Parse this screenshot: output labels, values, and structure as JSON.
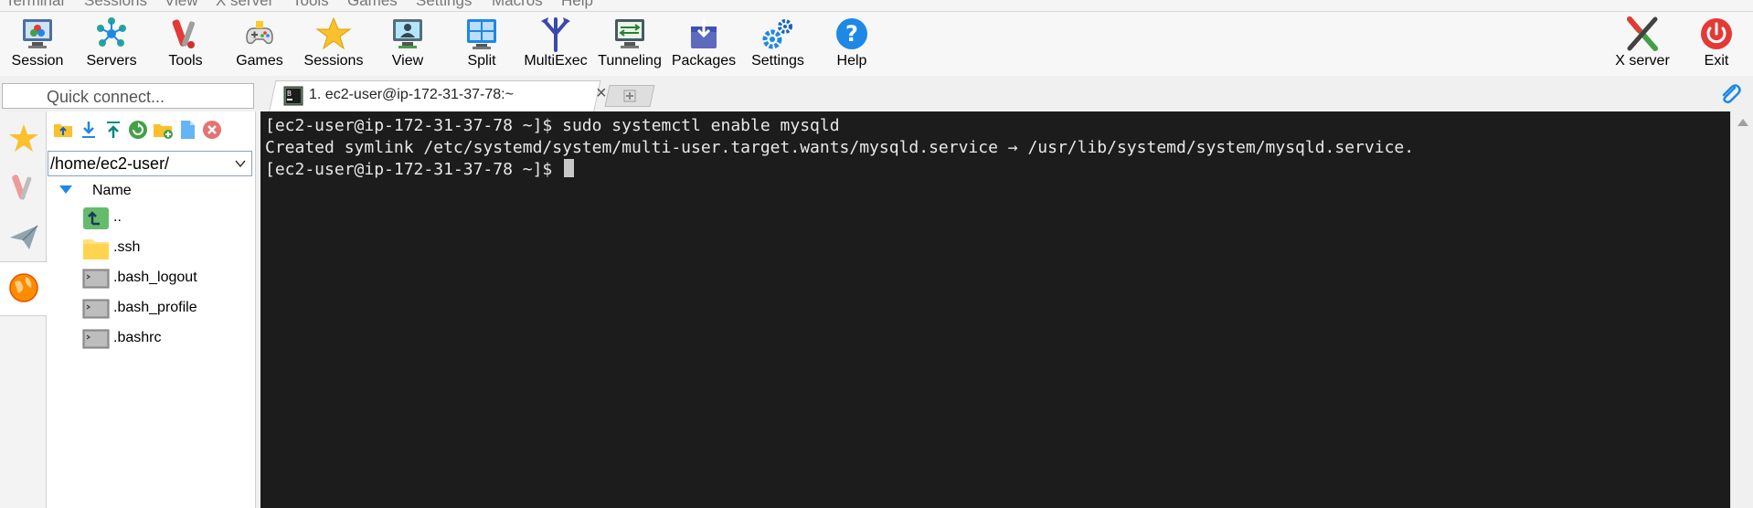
{
  "menubar": [
    "Terminal",
    "Sessions",
    "View",
    "X server",
    "Tools",
    "Games",
    "Settings",
    "Macros",
    "Help"
  ],
  "toolbar": {
    "buttons": [
      {
        "label": "Session",
        "icon": "session-icon"
      },
      {
        "label": "Servers",
        "icon": "servers-icon"
      },
      {
        "label": "Tools",
        "icon": "tools-icon"
      },
      {
        "label": "Games",
        "icon": "games-icon"
      },
      {
        "label": "Sessions",
        "icon": "sessions-star-icon"
      },
      {
        "label": "View",
        "icon": "view-icon"
      },
      {
        "label": "Split",
        "icon": "split-icon"
      },
      {
        "label": "MultiExec",
        "icon": "multiexec-icon"
      },
      {
        "label": "Tunneling",
        "icon": "tunneling-icon"
      },
      {
        "label": "Packages",
        "icon": "packages-icon"
      },
      {
        "label": "Settings",
        "icon": "settings-gears-icon"
      },
      {
        "label": "Help",
        "icon": "help-icon"
      }
    ],
    "right_buttons": [
      {
        "label": "X server",
        "icon": "xserver-icon"
      },
      {
        "label": "Exit",
        "icon": "power-icon"
      }
    ]
  },
  "quick_connect": {
    "placeholder": "Quick connect..."
  },
  "tabs": [
    {
      "title": "1. ec2-user@ip-172-31-37-78:~",
      "active": true
    }
  ],
  "sftp": {
    "path": "/home/ec2-user/",
    "column_header": "Name",
    "files": [
      {
        "name": "..",
        "icon": "parent-folder-icon"
      },
      {
        "name": ".ssh",
        "icon": "folder-icon"
      },
      {
        "name": ".bash_logout",
        "icon": "terminal-file-icon"
      },
      {
        "name": ".bash_profile",
        "icon": "terminal-file-icon"
      },
      {
        "name": ".bashrc",
        "icon": "terminal-file-icon"
      }
    ]
  },
  "terminal": {
    "lines": [
      "[ec2-user@ip-172-31-37-78 ~]$ sudo systemctl enable mysqld",
      "Created symlink /etc/systemd/system/multi-user.target.wants/mysqld.service → /usr/lib/systemd/system/mysqld.service.",
      "[ec2-user@ip-172-31-37-78 ~]$ "
    ]
  },
  "colors": {
    "terminal_bg": "#1c1c1c",
    "terminal_fg": "#e8e8e8",
    "accent_blue": "#1e88e5",
    "exit_red": "#e53935"
  }
}
